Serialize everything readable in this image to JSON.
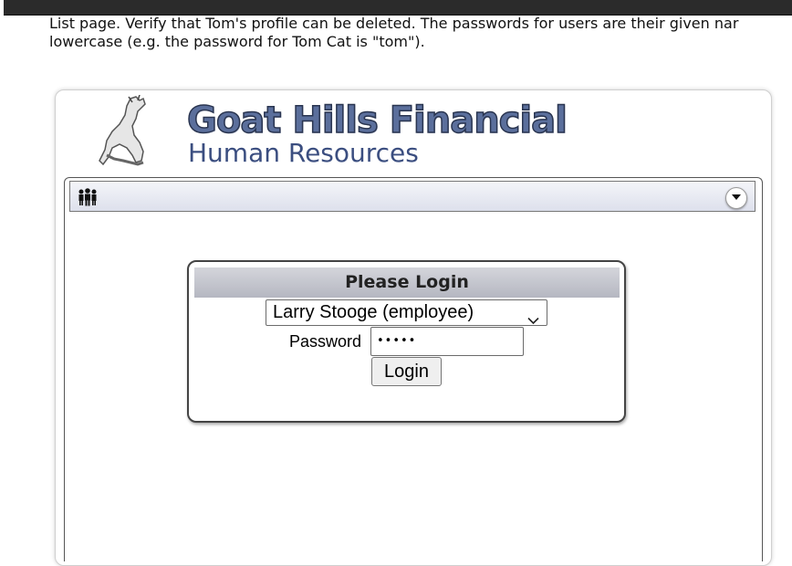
{
  "instructions": {
    "line1": "List page. Verify that Tom's profile can be deleted. The passwords for users are their given nar",
    "line2": "lowercase (e.g. the password for Tom Cat is \"tom\")."
  },
  "logo": {
    "title": "Goat Hills Financial",
    "subtitle": "Human Resources"
  },
  "app_bar": {
    "left_icon": "people-icon",
    "right_icon": "collapse-icon"
  },
  "login": {
    "heading": "Please Login",
    "user_select_value": "Larry Stooge (employee)",
    "password_label": "Password",
    "password_value": "•••••",
    "button_label": "Login"
  }
}
